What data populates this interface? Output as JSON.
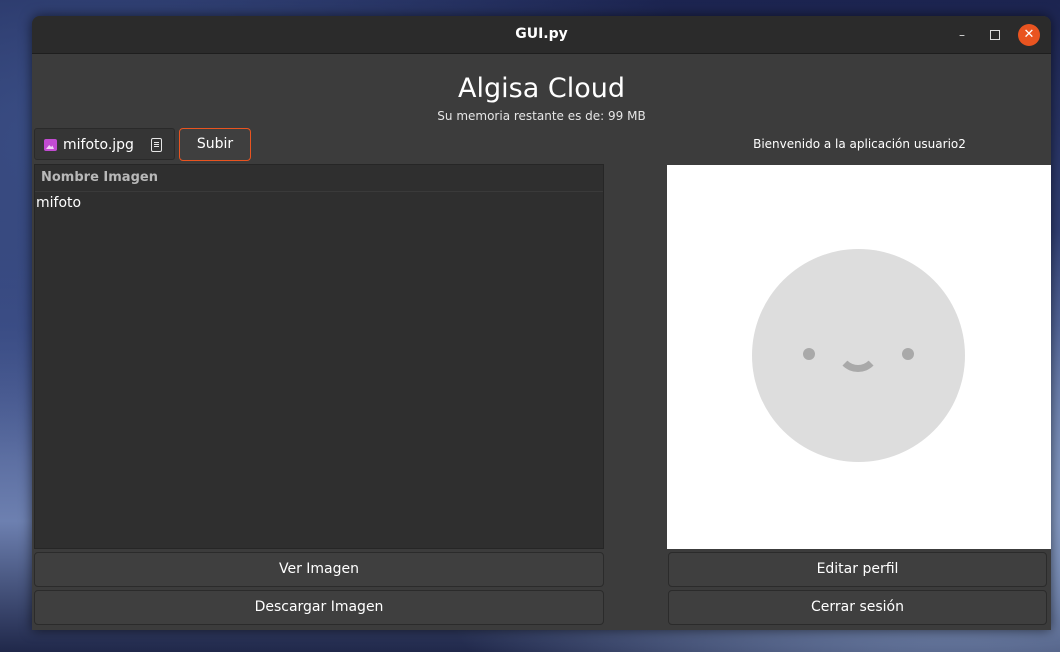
{
  "window": {
    "title": "GUI.py",
    "minimize_glyph": "–",
    "close_glyph": "✕"
  },
  "header": {
    "app_title": "Algisa Cloud",
    "memory_text": "Su memoria restante es de: 99 MB"
  },
  "upload": {
    "file_icon": "image-file-icon",
    "selected_file": "mifoto.jpg",
    "browse_icon": "document-icon",
    "upload_label": "Subir"
  },
  "welcome_text": "Bienvenido a la aplicación usuario2",
  "image_list": {
    "column_header": "Nombre Imagen",
    "items": [
      "mifoto"
    ]
  },
  "preview": {
    "icon": "smiley-placeholder-icon"
  },
  "buttons": {
    "view_image": "Ver Imagen",
    "download_image": "Descargar Imagen",
    "edit_profile": "Editar perfil",
    "logout": "Cerrar sesión"
  },
  "colors": {
    "accent": "#e95420",
    "window_bg": "#3c3c3c",
    "titlebar_bg": "#2b2b2b"
  }
}
